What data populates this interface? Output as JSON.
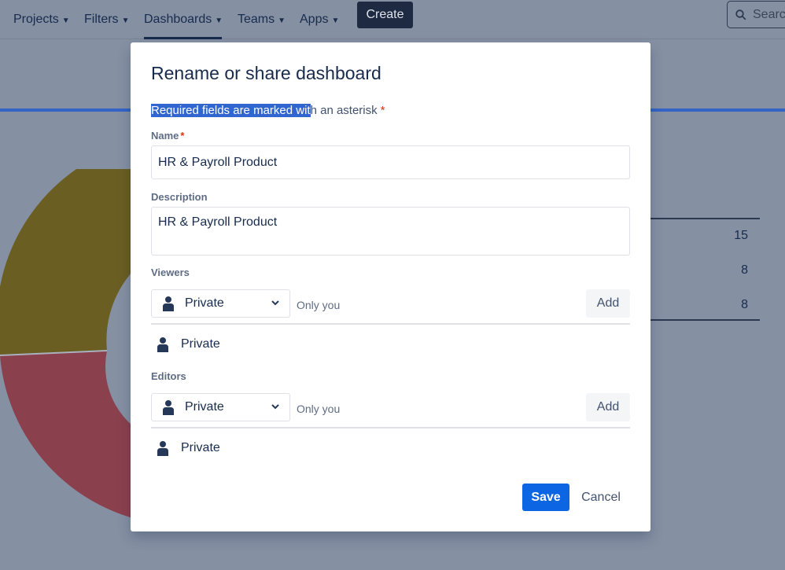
{
  "nav": {
    "items": [
      "Projects",
      "Filters",
      "Dashboards",
      "Teams",
      "Apps"
    ],
    "create_label": "Create",
    "search_placeholder": "Searc"
  },
  "background": {
    "table_values": [
      "15",
      "8",
      "8"
    ],
    "chart_colors": {
      "olive": "#6b5e22",
      "red": "#8b404e",
      "grey": "#8690a3"
    }
  },
  "modal": {
    "title": "Rename or share dashboard",
    "required_note_selected": "Required fields are marked wit",
    "required_note_rest": "h an asterisk",
    "asterisk": "*",
    "name_label": "Name",
    "name_value": "HR & Payroll Product",
    "description_label": "Description",
    "description_value": "HR & Payroll Product",
    "viewers": {
      "label": "Viewers",
      "select_value": "Private",
      "hint": "Only you",
      "add_label": "Add",
      "entries": [
        "Private"
      ]
    },
    "editors": {
      "label": "Editors",
      "select_value": "Private",
      "hint": "Only you",
      "add_label": "Add",
      "entries": [
        "Private"
      ]
    },
    "save_label": "Save",
    "cancel_label": "Cancel"
  },
  "colors": {
    "primary": "#0c66e4",
    "text": "#172b4d",
    "overlay": "#8690a3"
  }
}
